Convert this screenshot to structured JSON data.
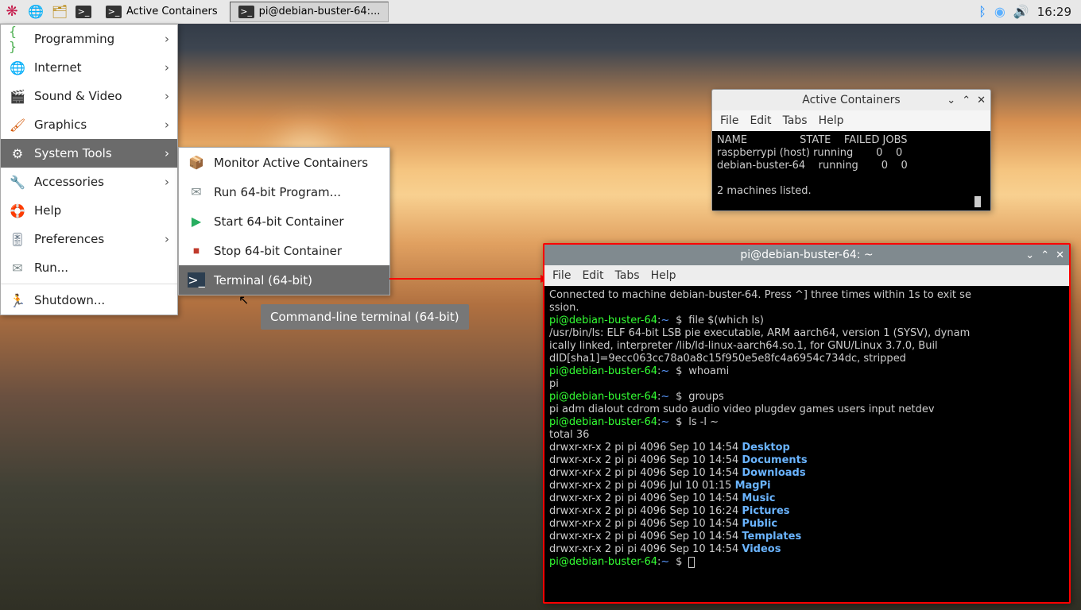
{
  "taskbar": {
    "entries": [
      {
        "label": "Active Containers"
      },
      {
        "label": "pi@debian-buster-64:..."
      }
    ],
    "clock": "16:29"
  },
  "menu": {
    "items": [
      {
        "label": "Programming",
        "icon": "{ }"
      },
      {
        "label": "Internet",
        "icon": "🌐"
      },
      {
        "label": "Sound & Video",
        "icon": "🎬"
      },
      {
        "label": "Graphics",
        "icon": "🖌"
      },
      {
        "label": "System Tools",
        "icon": "⚙"
      },
      {
        "label": "Accessories",
        "icon": "🔧"
      },
      {
        "label": "Help",
        "icon": "🛟"
      },
      {
        "label": "Preferences",
        "icon": "🎚"
      },
      {
        "label": "Run...",
        "icon": "✉"
      },
      {
        "label": "Shutdown...",
        "icon": "🏃"
      }
    ]
  },
  "submenu": {
    "items": [
      {
        "label": "Monitor Active Containers",
        "icon": "📦"
      },
      {
        "label": "Run 64-bit Program...",
        "icon": "✉"
      },
      {
        "label": "Start 64-bit Container",
        "icon": "▶"
      },
      {
        "label": "Stop 64-bit Container",
        "icon": "⏹"
      },
      {
        "label": "Terminal (64-bit)",
        "icon": ">_"
      }
    ]
  },
  "tooltip": "Command-line terminal (64-bit)",
  "win1": {
    "title": "Active Containers",
    "menubar": [
      "File",
      "Edit",
      "Tabs",
      "Help"
    ],
    "head": "NAME                STATE    FAILED JOBS",
    "rows": [
      "raspberrypi (host) running       0    0",
      "debian-buster-64    running       0    0"
    ],
    "footer": "2 machines listed."
  },
  "win2": {
    "title": "pi@debian-buster-64: ~",
    "menubar": [
      "File",
      "Edit",
      "Tabs",
      "Help"
    ],
    "prompt_user": "pi@debian-buster-64",
    "prompt_path": "~",
    "dollar": "$",
    "line0": "Connected to machine debian-buster-64. Press ^] three times within 1s to exit se",
    "line0b": "ssion.",
    "cmd1": "file $(which ls)",
    "out1a": "/usr/bin/ls: ELF 64-bit LSB pie executable, ARM aarch64, version 1 (SYSV), dynam",
    "out1b": "ically linked, interpreter /lib/ld-linux-aarch64.so.1, for GNU/Linux 3.7.0, Buil",
    "out1c": "dID[sha1]=9ecc063cc78a0a8c15f950e5e8fc4a6954c734dc, stripped",
    "cmd2": "whoami",
    "out2": "pi",
    "cmd3": "groups",
    "out3": "pi adm dialout cdrom sudo audio video plugdev games users input netdev",
    "cmd4": "ls -l ~",
    "total": "total 36",
    "ls": [
      {
        "perm": "drwxr-xr-x 2 pi pi 4096 Sep 10 14:54 ",
        "name": "Desktop"
      },
      {
        "perm": "drwxr-xr-x 2 pi pi 4096 Sep 10 14:54 ",
        "name": "Documents"
      },
      {
        "perm": "drwxr-xr-x 2 pi pi 4096 Sep 10 14:54 ",
        "name": "Downloads"
      },
      {
        "perm": "drwxr-xr-x 2 pi pi 4096 Jul 10 01:15 ",
        "name": "MagPi"
      },
      {
        "perm": "drwxr-xr-x 2 pi pi 4096 Sep 10 14:54 ",
        "name": "Music"
      },
      {
        "perm": "drwxr-xr-x 2 pi pi 4096 Sep 10 16:24 ",
        "name": "Pictures"
      },
      {
        "perm": "drwxr-xr-x 2 pi pi 4096 Sep 10 14:54 ",
        "name": "Public"
      },
      {
        "perm": "drwxr-xr-x 2 pi pi 4096 Sep 10 14:54 ",
        "name": "Templates"
      },
      {
        "perm": "drwxr-xr-x 2 pi pi 4096 Sep 10 14:54 ",
        "name": "Videos"
      }
    ]
  }
}
